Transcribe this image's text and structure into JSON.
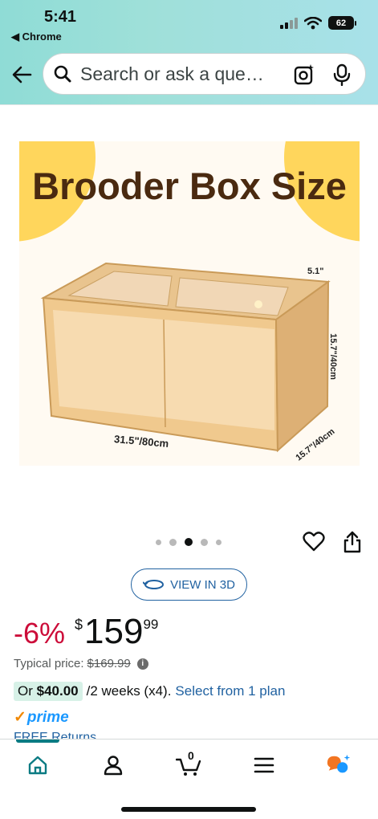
{
  "status": {
    "time": "5:41",
    "back_app": "◀ Chrome",
    "battery": "62"
  },
  "search": {
    "placeholder": "Search or ask a que…"
  },
  "product": {
    "image_title": "Brooder Box Size",
    "dim_width": "31.5\"/80cm",
    "dim_height": "15.7\"/40cm",
    "dim_depth": "15.7\"/40cm",
    "dim_lid": "5.1\"",
    "carousel": {
      "count": 5,
      "active_index": 2
    },
    "view3d_label": "VIEW IN 3D",
    "discount": "-6%",
    "currency": "$",
    "price_whole": "159",
    "price_cents": "99",
    "typical_label": "Typical price:",
    "typical_value": "$169.99",
    "plan_amount_prefix": "Or ",
    "plan_amount": "$40.00",
    "plan_terms": " /2 weeks (x4).",
    "plan_link": "Select from 1 plan",
    "prime_label": "prime",
    "free_returns": "FREE Returns"
  },
  "nav": {
    "cart_count": "0",
    "items": [
      "home-icon",
      "account-icon",
      "cart-icon",
      "menu-icon",
      "rufus-icon"
    ]
  },
  "colors": {
    "link": "#2162a1",
    "deal": "#cc0c39",
    "prime": "#1a98ff",
    "header_start": "#8fdcd6",
    "header_end": "#a8e1e9"
  }
}
